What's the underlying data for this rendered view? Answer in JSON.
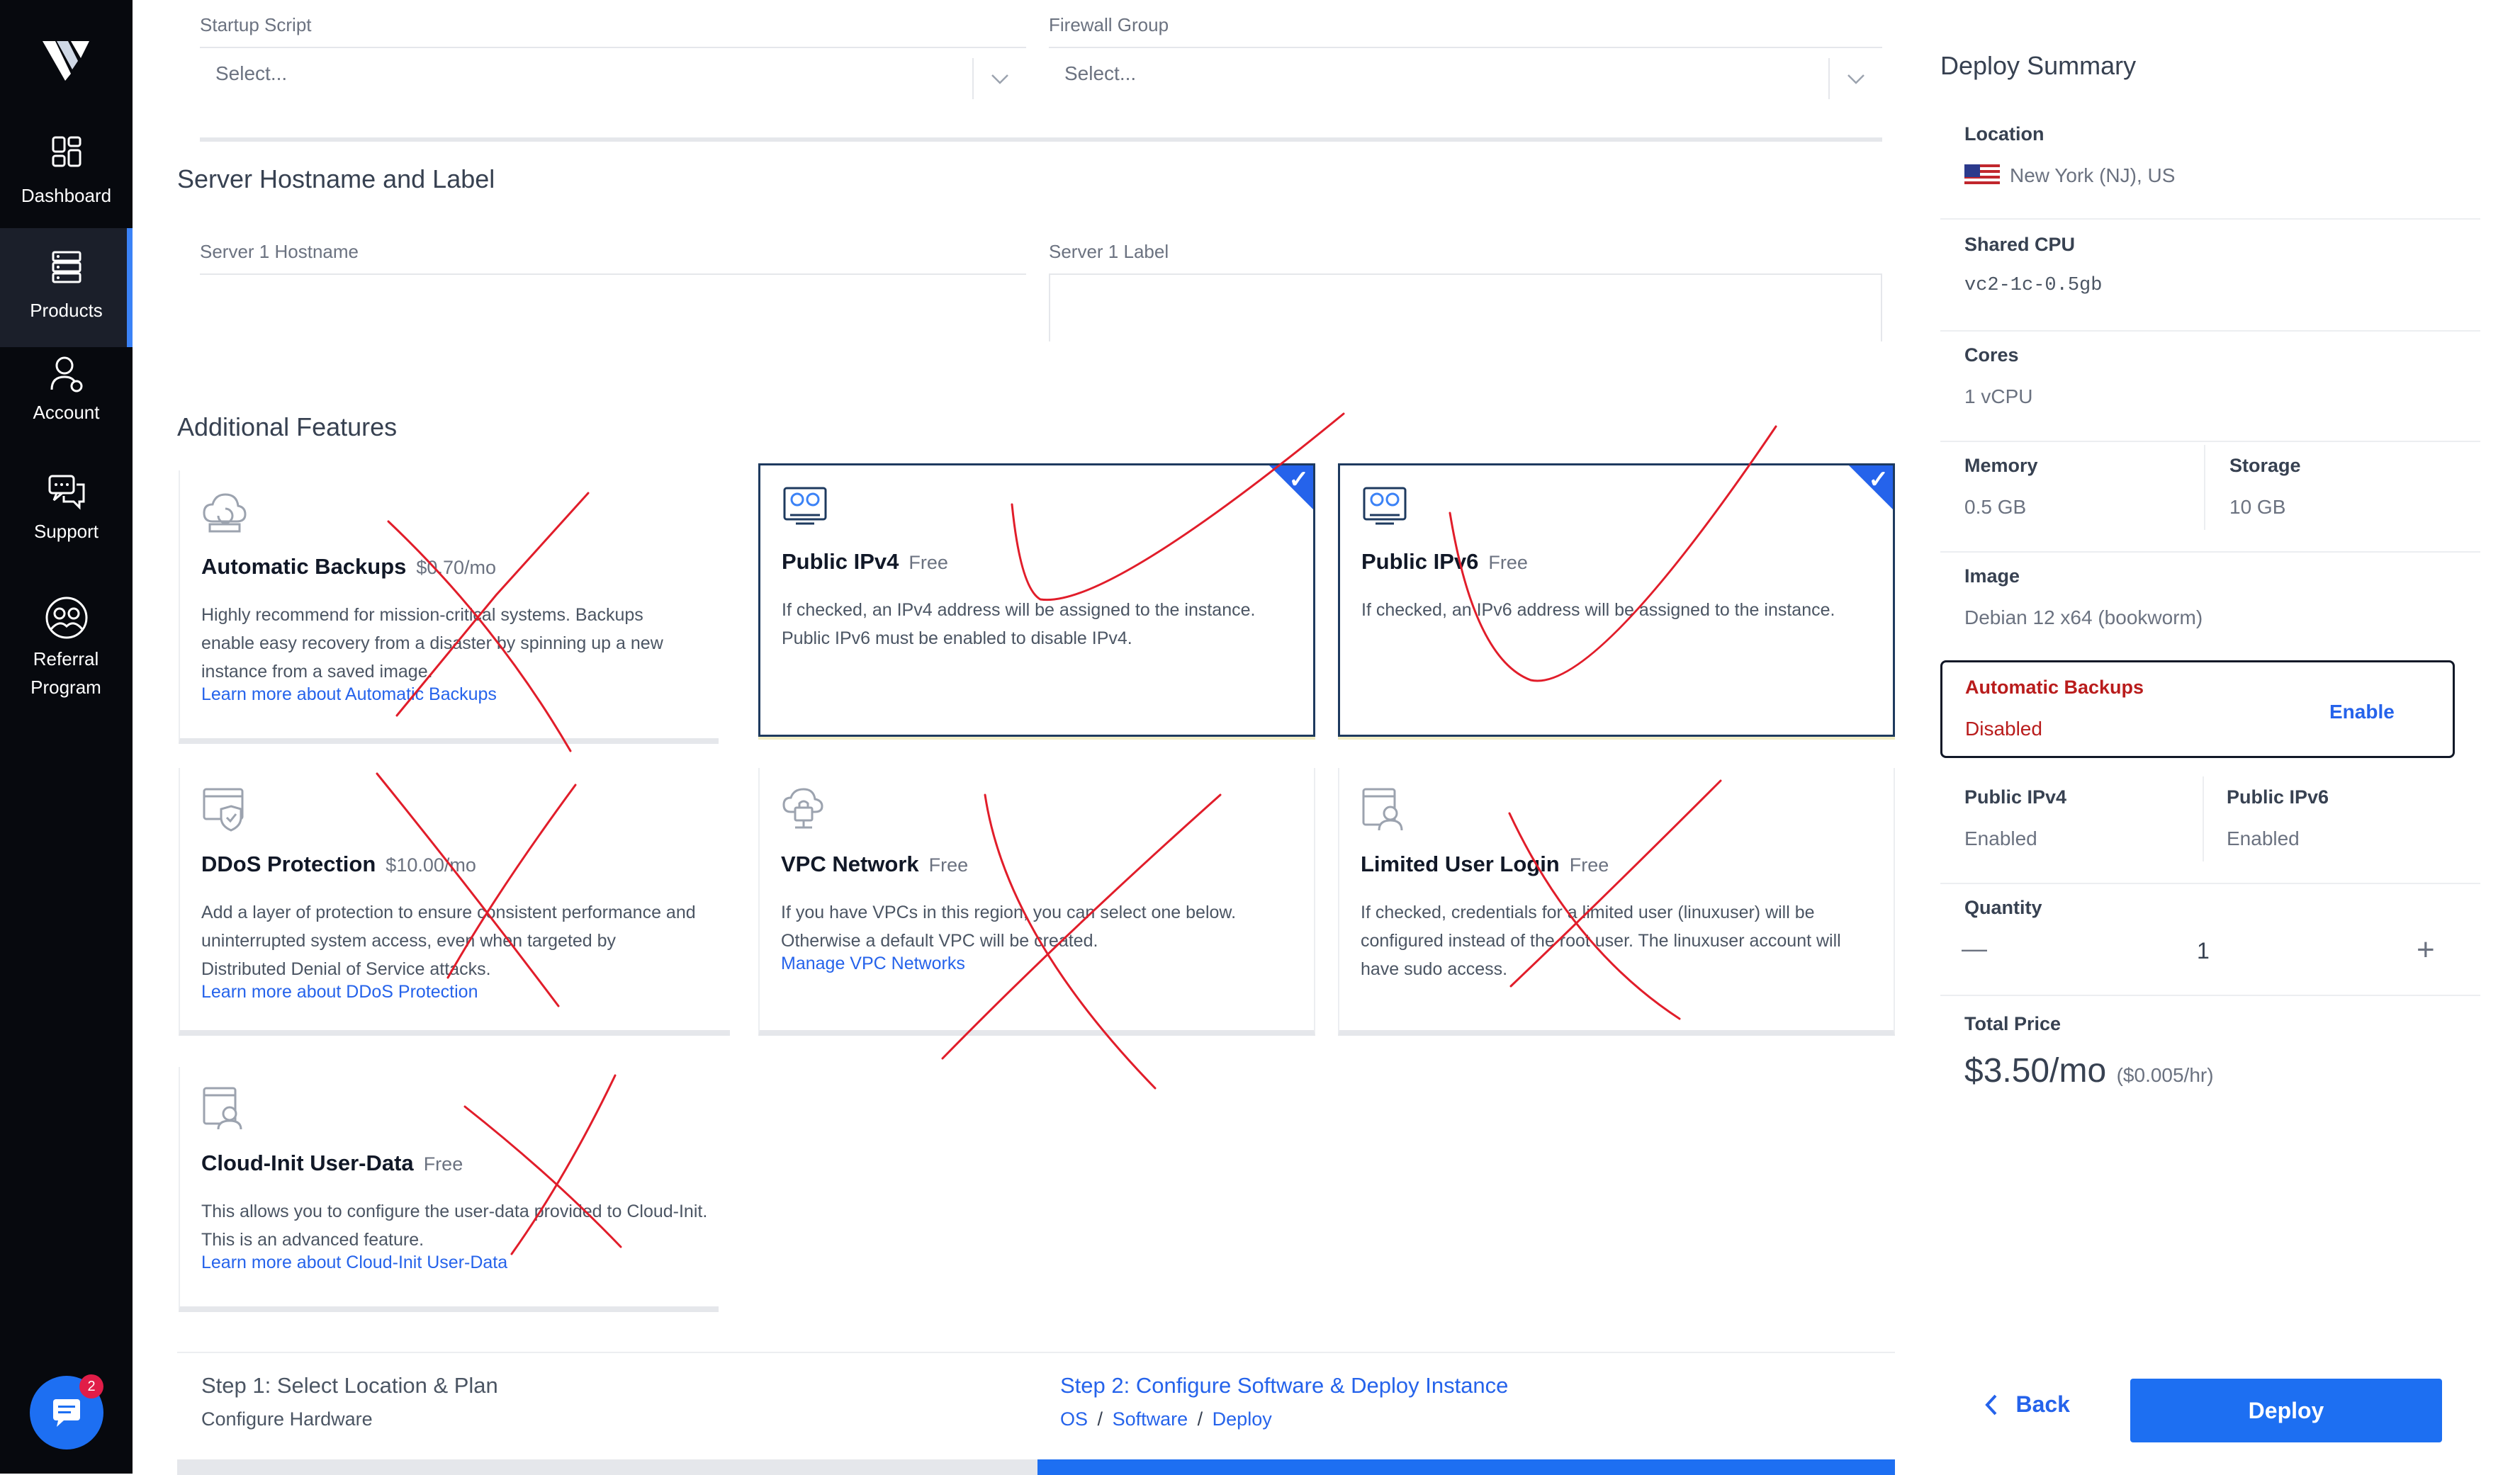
{
  "nav": [
    {
      "label": "Dashboard",
      "icon": "dashboard-icon"
    },
    {
      "label": "Products",
      "icon": "products-icon"
    },
    {
      "label": "Account",
      "icon": "account-icon"
    },
    {
      "label": "Support",
      "icon": "support-icon"
    },
    {
      "label": "Referral Program",
      "icon": "referral-icon"
    }
  ],
  "chat_badge": "2",
  "startup": {
    "label": "Startup Script",
    "value": "Select..."
  },
  "firewall": {
    "label": "Firewall Group",
    "value": "Select..."
  },
  "hostname_section": {
    "title": "Server Hostname and Label",
    "hostname_label": "Server 1 Hostname",
    "label_label": "Server 1 Label"
  },
  "features": {
    "title": "Additional Features",
    "items": [
      {
        "title": "Automatic Backups",
        "price": "$0.70/mo",
        "desc": "Highly recommend for mission-critical systems. Backups enable easy recovery from a disaster by spinning up a new instance from a saved image.",
        "link": "Learn more about Automatic Backups",
        "checked": false
      },
      {
        "title": "Public IPv4",
        "price": "Free",
        "desc": "If checked, an IPv4 address will be assigned to the instance. Public IPv6 must be enabled to disable IPv4.",
        "checked": true
      },
      {
        "title": "Public IPv6",
        "price": "Free",
        "desc": "If checked, an IPv6 address will be assigned to the instance.",
        "checked": true
      },
      {
        "title": "DDoS Protection",
        "price": "$10.00/mo",
        "desc": "Add a layer of protection to ensure consistent performance and uninterrupted system access, even when targeted by Distributed Denial of Service attacks.",
        "link": "Learn more about DDoS Protection",
        "checked": false
      },
      {
        "title": "VPC Network",
        "price": "Free",
        "desc": "If you have VPCs in this region, you can select one below. Otherwise a default VPC will be created.",
        "link": "Manage VPC Networks",
        "checked": false
      },
      {
        "title": "Limited User Login",
        "price": "Free",
        "desc": "If checked, credentials for a limited user (linuxuser) will be configured instead of the root user. The linuxuser account will have sudo access.",
        "checked": false
      },
      {
        "title": "Cloud-Init User-Data",
        "price": "Free",
        "desc": "This allows you to configure the user-data provided to Cloud-Init. This is an advanced feature.",
        "link": "Learn more about Cloud-Init User-Data",
        "checked": false
      }
    ]
  },
  "summary": {
    "title": "Deploy Summary",
    "location_label": "Location",
    "location_value": "New York (NJ), US",
    "plan_label": "Shared CPU",
    "plan_value": "vc2-1c-0.5gb",
    "cores_label": "Cores",
    "cores_value": "1 vCPU",
    "memory_label": "Memory",
    "memory_value": "0.5 GB",
    "storage_label": "Storage",
    "storage_value": "10 GB",
    "image_label": "Image",
    "image_value": "Debian 12 x64 (bookworm)",
    "backups_label": "Automatic Backups",
    "backups_value": "Disabled",
    "backups_action": "Enable",
    "ipv4_label": "Public IPv4",
    "ipv4_value": "Enabled",
    "ipv6_label": "Public IPv6",
    "ipv6_value": "Enabled",
    "quantity_label": "Quantity",
    "quantity_value": "1",
    "quantity_minus": "—",
    "quantity_plus": "+",
    "total_label": "Total Price",
    "total_value": "$3.50/mo",
    "total_hourly": "($0.005/hr)"
  },
  "steps": {
    "step1_title": "Step 1: Select Location & Plan",
    "step1_sub": "Configure Hardware",
    "step2_title": "Step 2: Configure Software & Deploy Instance",
    "step2_links": [
      "OS",
      "Software",
      "Deploy"
    ],
    "step2_sep": "/"
  },
  "actions": {
    "back": "Back",
    "deploy": "Deploy"
  },
  "colors": {
    "accent": "#2563eb",
    "sidebar": "#07090e",
    "danger": "#b91c1c",
    "annotation": "#e11d2a"
  }
}
